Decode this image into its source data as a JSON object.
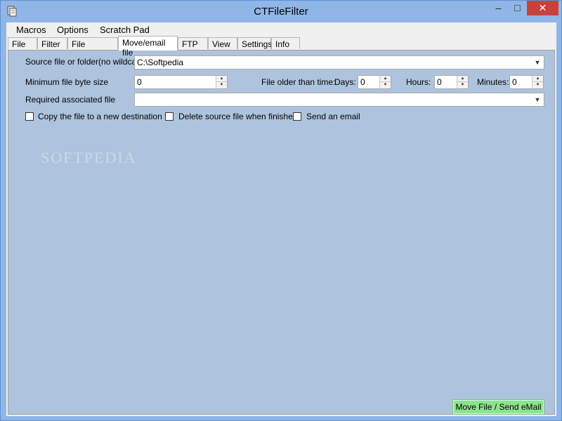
{
  "window": {
    "title": "CTFileFilter",
    "controls": {
      "minimize": "–",
      "maximize": "□",
      "close": "✕"
    },
    "accent_title_bar": "#8fb6e6",
    "close_color": "#c7433a"
  },
  "menu": {
    "items": [
      "Macros",
      "Options",
      "Scratch Pad"
    ]
  },
  "tabs": {
    "items": [
      "File",
      "Filter",
      "File renaming",
      "Move/email file",
      "FTP",
      "View",
      "Settings",
      "Info"
    ],
    "active": "Move/email file"
  },
  "form": {
    "source_label": "Source file or folder(no wildcard)",
    "source_value": "C:\\Softpedia",
    "min_size_label": "Minimum file byte size",
    "min_size_value": "0",
    "older_than_label": "File older than time:",
    "days_label": "Days:",
    "days_value": "0",
    "hours_label": "Hours:",
    "hours_value": "0",
    "minutes_label": "Minutes:",
    "minutes_value": "0",
    "assoc_label": "Required associated file",
    "assoc_value": "",
    "copy_label": "Copy the file to a new destination",
    "delete_label": "Delete source file when finished",
    "email_label": "Send an email",
    "copy_checked": false,
    "delete_checked": false,
    "email_checked": false
  },
  "action": {
    "label": "Move File / Send eMail",
    "color": "#8fe38f"
  },
  "watermark": "SOFTPEDIA"
}
